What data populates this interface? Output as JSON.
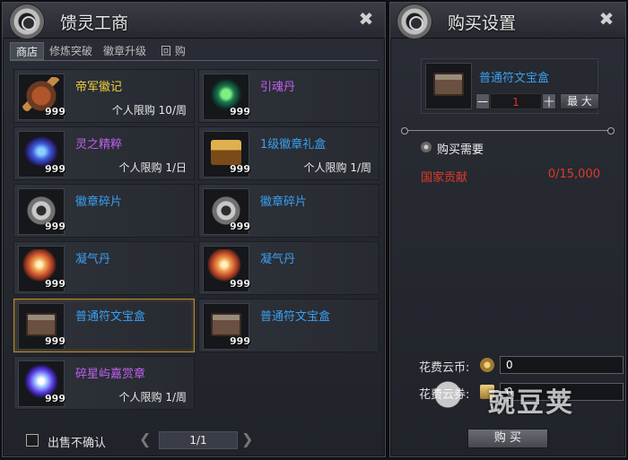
{
  "left_panel": {
    "title": "馈灵工商",
    "tabs": [
      {
        "label": "商店",
        "active": true
      },
      {
        "label": "修炼突破",
        "active": false
      },
      {
        "label": "徽章升级",
        "active": false
      },
      {
        "label": "回 购",
        "active": false
      }
    ],
    "items": [
      {
        "name": "帝军徽记",
        "color": "#f0d23c",
        "qty": "999",
        "limit": "个人限购 10/周",
        "icon": "badge-icon"
      },
      {
        "name": "引魂丹",
        "color": "#c060f0",
        "qty": "999",
        "limit": "",
        "icon": "pill-icon"
      },
      {
        "name": "灵之精粹",
        "color": "#c060f0",
        "qty": "999",
        "limit": "个人限购 1/日",
        "icon": "crystal-icon"
      },
      {
        "name": "1级徽章礼盒",
        "color": "#3aa0f0",
        "qty": "999",
        "limit": "个人限购 1/周",
        "icon": "chest-icon"
      },
      {
        "name": "徽章碎片",
        "color": "#3aa0f0",
        "qty": "999",
        "limit": "",
        "icon": "shard-icon"
      },
      {
        "name": "徽章碎片",
        "color": "#3aa0f0",
        "qty": "999",
        "limit": "",
        "icon": "shard-icon"
      },
      {
        "name": "凝气丹",
        "color": "#3aa0f0",
        "qty": "999",
        "limit": "",
        "icon": "orb-icon"
      },
      {
        "name": "凝气丹",
        "color": "#3aa0f0",
        "qty": "999",
        "limit": "",
        "icon": "orb-icon"
      },
      {
        "name": "普通符文宝盒",
        "color": "#3aa0f0",
        "qty": "999",
        "limit": "",
        "icon": "box-icon",
        "selected": true
      },
      {
        "name": "普通符文宝盒",
        "color": "#3aa0f0",
        "qty": "999",
        "limit": "",
        "icon": "box-icon"
      },
      {
        "name": "碎星屿嘉赏章",
        "color": "#c060f0",
        "qty": "999",
        "limit": "个人限购 1/周",
        "icon": "star-icon"
      }
    ],
    "footer": {
      "no_confirm_label": "出售不确认",
      "page": "1/1",
      "prev_icon": "chevron-left-icon",
      "next_icon": "chevron-right-icon"
    }
  },
  "right_panel": {
    "title": "购买设置",
    "item_name": "普通符文宝盒",
    "minus": "一",
    "quantity": "1",
    "plus": "十",
    "max_label": "最 大",
    "need_label": "购买需要",
    "contrib_label": "国家贡献",
    "contrib_value": "0/15,000",
    "cost_coin_label": "花费云币:",
    "cost_coin_value": "0",
    "cost_ticket_label": "花费云券:",
    "cost_ticket_value": "0",
    "buy_label": "购 买"
  },
  "watermark": {
    "text": "豌豆荚"
  }
}
